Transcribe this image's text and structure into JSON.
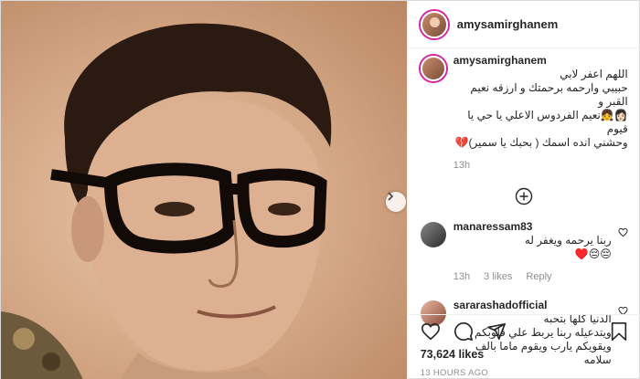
{
  "post": {
    "username": "amysamirghanem",
    "caption_lines": [
      "اللهم اعفر لابي",
      "حبيبي وارحمه برحمتك و ارزقه نعيم القبر و",
      "👩🏻‍👧نعيم الفردوس الاعلي يا حي يا قيوم",
      "وحشني انده اسمك ( بحبك يا سمير)💔"
    ],
    "caption_time": "13h"
  },
  "comments": [
    {
      "username": "manaressam83",
      "text_lines": [
        "ربنا يرحمه ويغفر له",
        "😔😔♥️"
      ],
      "time": "13h",
      "likes": "3 likes",
      "reply": "Reply"
    },
    {
      "username": "sararashadofficial",
      "text_lines": [
        "الدنيا كلها بتحبه",
        "ويتدعيله ربنا يربط علي قلوبكم",
        "ويقويكم يارب ويقوم ماما بالف",
        "سلامه"
      ]
    }
  ],
  "actions": {
    "likes": "73,624 likes",
    "timestamp": "13 HOURS AGO"
  },
  "icons": {
    "like": "heart-icon",
    "comment": "comment-icon",
    "share": "share-icon",
    "save": "bookmark-icon",
    "load_more": "plus-circle-icon",
    "next": "chevron-right-icon"
  },
  "colors": {
    "story_ring": "#d6249f",
    "muted_text": "#8e8e8e",
    "photo_tone": "#d7ab8a"
  }
}
